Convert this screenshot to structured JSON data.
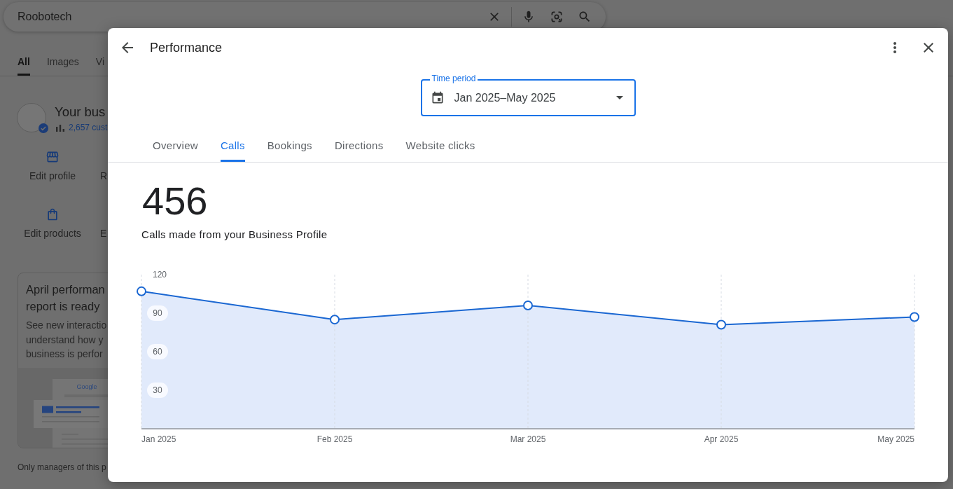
{
  "search": {
    "query": "Roobotech"
  },
  "search_tabs": [
    {
      "label": "All",
      "selected": true
    },
    {
      "label": "Images",
      "selected": false
    },
    {
      "label": "Vi",
      "selected": false
    }
  ],
  "business": {
    "name": "Your bus",
    "stat": "2,657 cust",
    "verified": true
  },
  "actions": [
    {
      "kind": "store",
      "label": "Edit profile"
    },
    {
      "kind": "text",
      "label": "R"
    },
    {
      "kind": "bag",
      "label": "Edit products"
    },
    {
      "kind": "text",
      "label": "E"
    }
  ],
  "report_card": {
    "title_lines": [
      "April performan",
      "report is ready"
    ],
    "body_lines": [
      "See new interactio",
      "understand how y",
      "business is perfor"
    ],
    "illustration_logo": "Google"
  },
  "footer_note": "Only managers of this p",
  "dialog": {
    "title": "Performance",
    "time_period": {
      "label": "Time period",
      "value": "Jan 2025–May 2025"
    },
    "tabs": [
      {
        "label": "Overview",
        "selected": false
      },
      {
        "label": "Calls",
        "selected": true
      },
      {
        "label": "Bookings",
        "selected": false
      },
      {
        "label": "Directions",
        "selected": false
      },
      {
        "label": "Website clicks",
        "selected": false
      }
    ],
    "metric": {
      "value": "456",
      "caption": "Calls made from your Business Profile"
    },
    "chart_data": {
      "type": "area",
      "categories": [
        "Jan 2025",
        "Feb 2025",
        "Mar 2025",
        "Apr 2025",
        "May 2025"
      ],
      "values": [
        107,
        85,
        96,
        81,
        87
      ],
      "ylim": [
        0,
        120
      ],
      "yticks": [
        30,
        60,
        90,
        120
      ],
      "grid": true
    }
  }
}
